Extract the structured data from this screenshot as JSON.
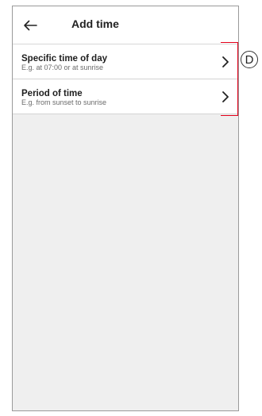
{
  "header": {
    "back_icon": "arrow-left-icon",
    "title": "Add time"
  },
  "options": [
    {
      "title": "Specific time of day",
      "subtitle": "E.g. at 07:00 or at sunrise",
      "icon": "chevron-right-icon"
    },
    {
      "title": "Period of time",
      "subtitle": "E.g. from sunset to sunrise",
      "icon": "chevron-right-icon"
    }
  ],
  "annotation": {
    "label": "D",
    "color": "#e2001a"
  }
}
